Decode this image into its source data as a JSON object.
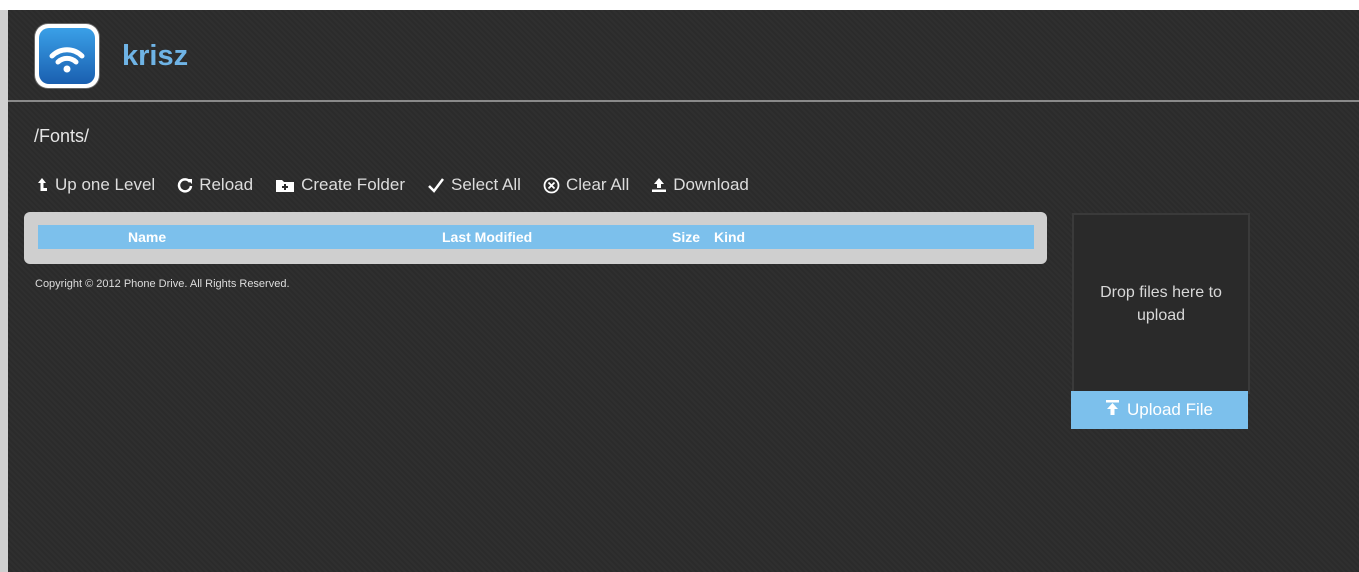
{
  "header": {
    "app_name": "krisz",
    "icon": "wifi-folder-icon"
  },
  "breadcrumb": "/Fonts/",
  "toolbar": {
    "up_label": "Up one Level",
    "reload_label": "Reload",
    "create_folder_label": "Create Folder",
    "select_all_label": "Select All",
    "clear_all_label": "Clear All",
    "download_label": "Download"
  },
  "table": {
    "columns": [
      "Name",
      "Last Modified",
      "Size",
      "Kind"
    ]
  },
  "footer": {
    "copyright": "Copyright © 2012 Phone Drive. All Rights Reserved."
  },
  "upload": {
    "drop_text": "Drop files here to upload",
    "button_label": "Upload File"
  },
  "colors": {
    "accent": "#7cc0ec",
    "background": "#2c2c2c",
    "app_name": "#6fb4e6"
  }
}
